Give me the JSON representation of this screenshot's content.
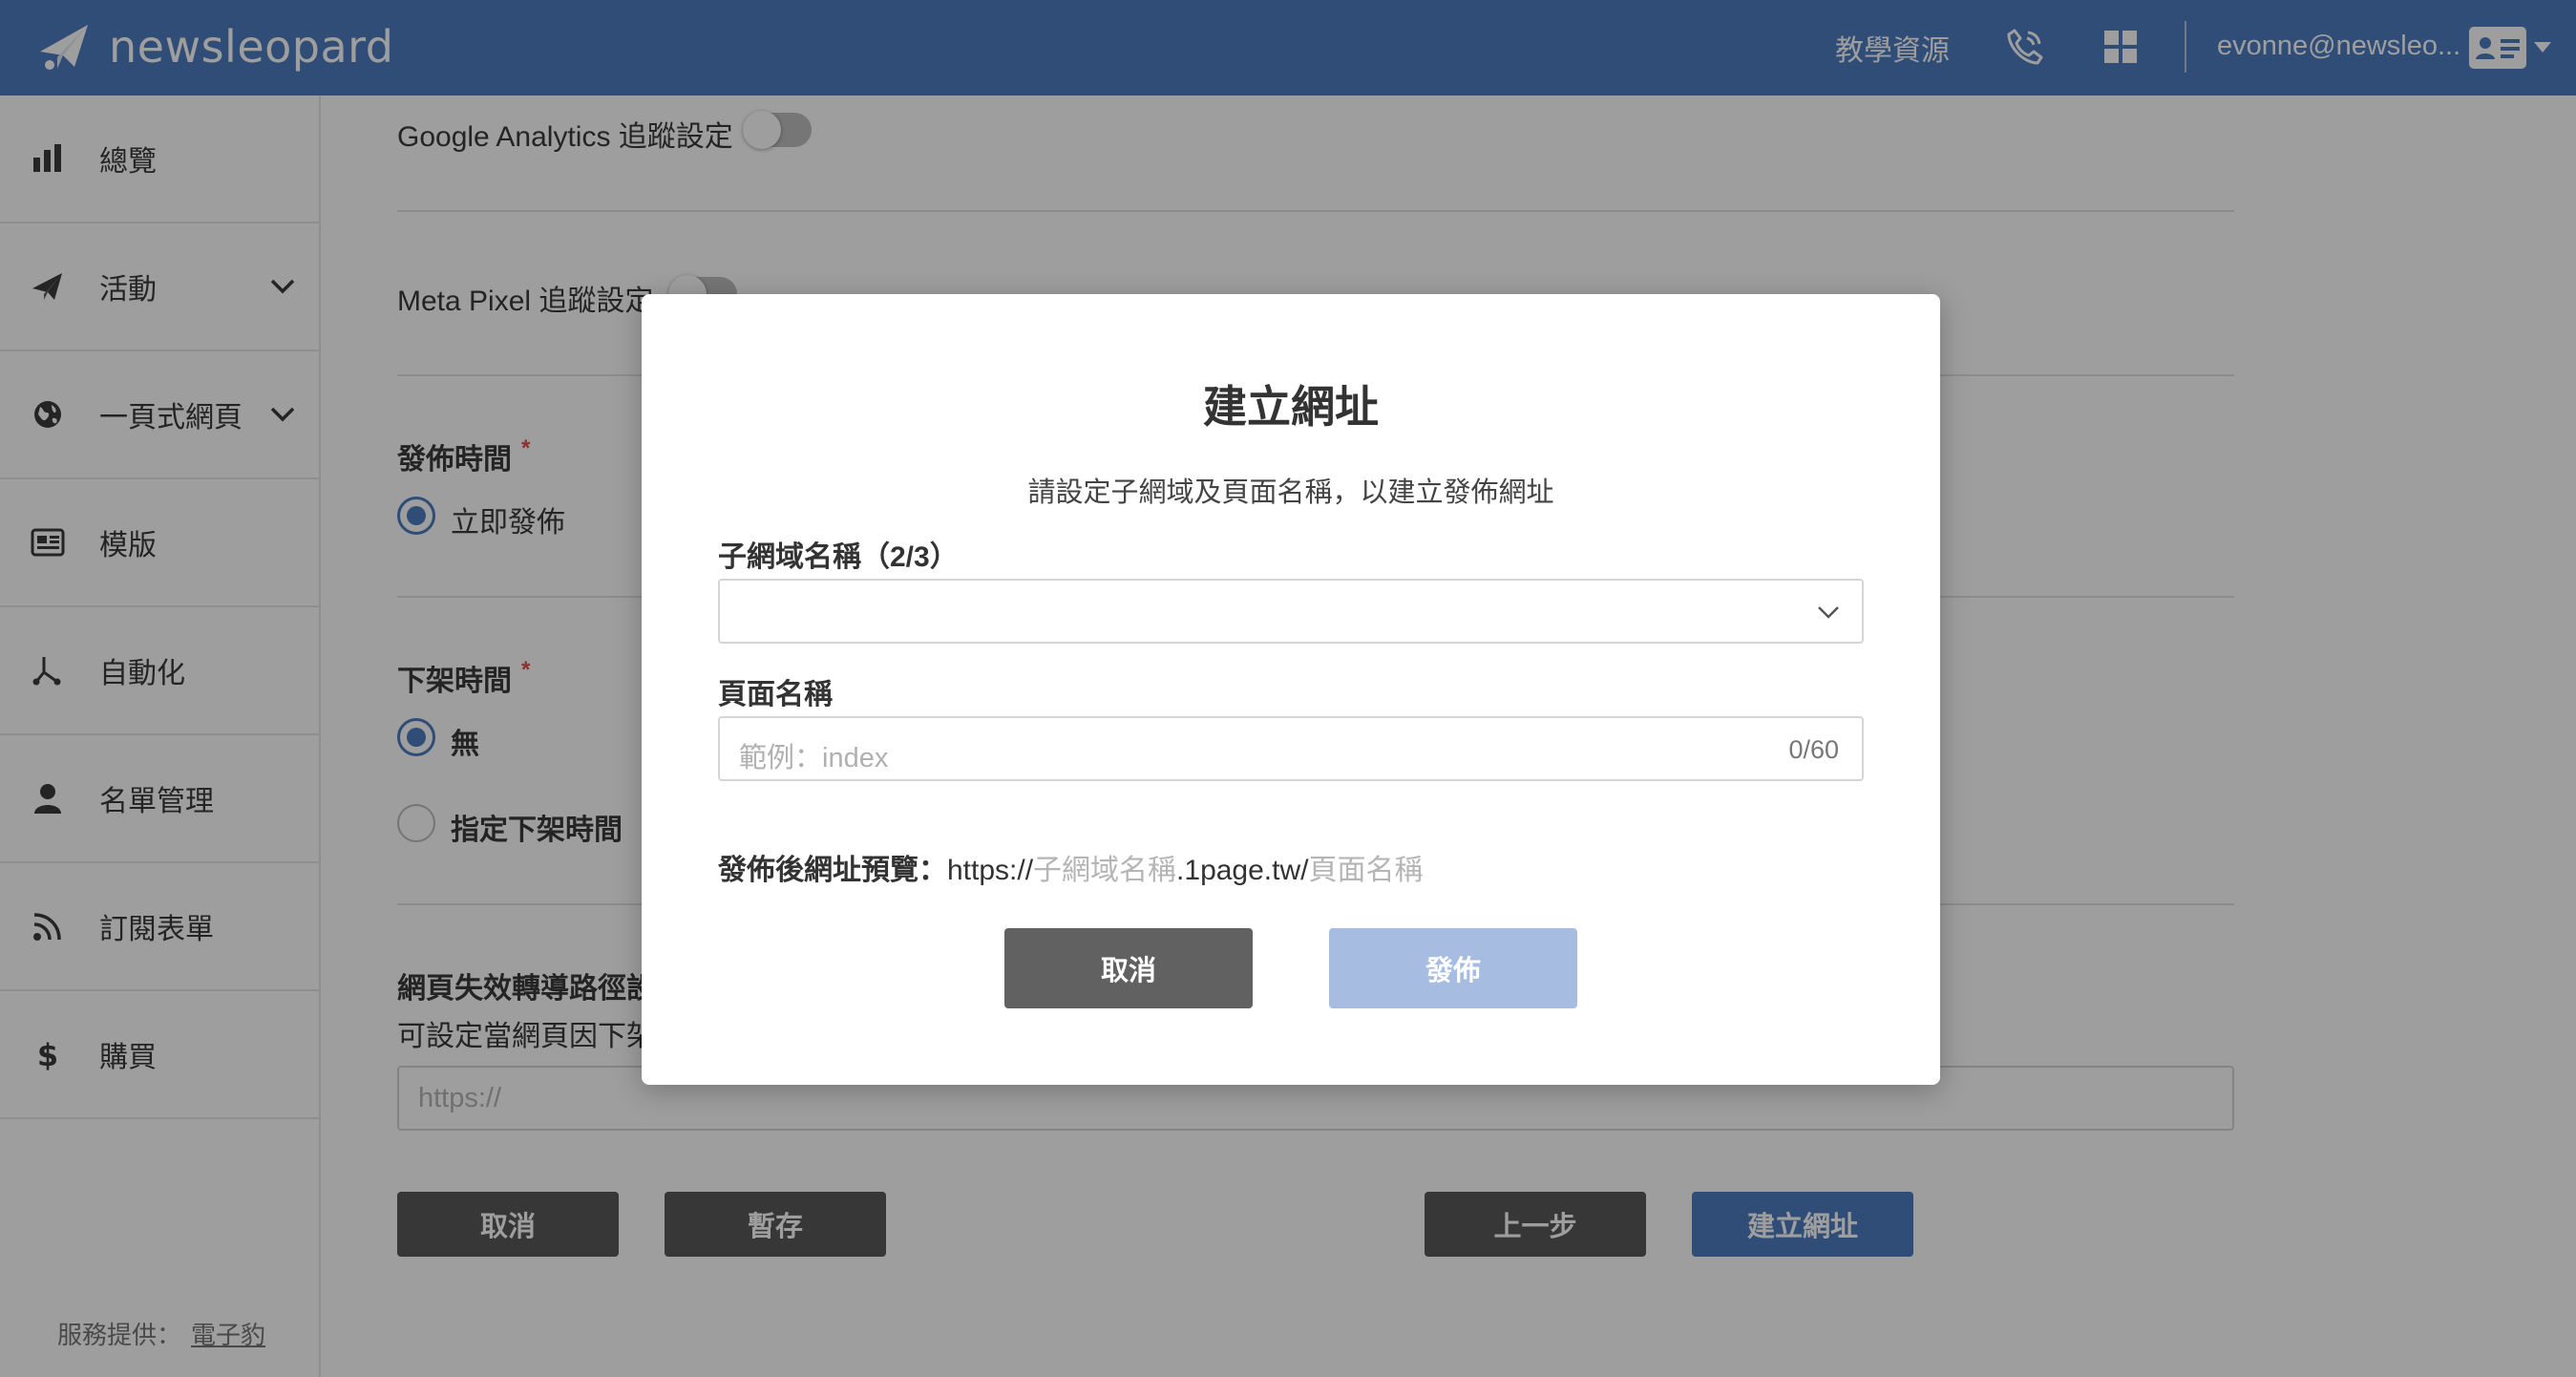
{
  "header": {
    "brand": "newsleopard",
    "resources_label": "教學資源",
    "user_email": "evonne@newsleo...",
    "colors": {
      "bar": "#4e7cc2"
    }
  },
  "sidebar": {
    "items": [
      {
        "label": "總覽",
        "icon": "bar-chart-icon",
        "has_submenu": false
      },
      {
        "label": "活動",
        "icon": "paper-plane-icon",
        "has_submenu": true
      },
      {
        "label": "一頁式網頁",
        "icon": "globe-icon",
        "has_submenu": true
      },
      {
        "label": "模版",
        "icon": "template-icon",
        "has_submenu": false
      },
      {
        "label": "自動化",
        "icon": "automation-icon",
        "has_submenu": false
      },
      {
        "label": "名單管理",
        "icon": "user-icon",
        "has_submenu": false
      },
      {
        "label": "訂閱表單",
        "icon": "rss-icon",
        "has_submenu": false
      },
      {
        "label": "購買",
        "icon": "dollar-icon",
        "has_submenu": false
      }
    ],
    "footer": {
      "prefix": "服務提供：",
      "link": "電子豹"
    }
  },
  "main": {
    "ga_label": "Google Analytics 追蹤設定",
    "meta_label": "Meta Pixel 追蹤設定",
    "publish_time": {
      "label": "發佈時間",
      "required_mark": "*",
      "option_now": "立即發佈"
    },
    "unpublish_time": {
      "label": "下架時間",
      "required_mark": "*",
      "option_none": "無",
      "option_specific": "指定下架時間"
    },
    "redirect": {
      "label": "網頁失效轉導路徑設",
      "description": "可設定當網頁因下架",
      "placeholder": "https://"
    },
    "buttons": {
      "cancel": "取消",
      "save_draft": "暫存",
      "previous": "上一步",
      "create_url": "建立網址"
    }
  },
  "modal": {
    "title": "建立網址",
    "subtitle": "請設定子網域及頁面名稱，以建立發佈網址",
    "subdomain_label": "子網域名稱（2/3）",
    "subdomain_value": "",
    "page_name_label": "頁面名稱",
    "page_name_placeholder": "範例：index",
    "page_name_counter": "0/60",
    "preview_label": "發佈後網址預覽：",
    "preview_scheme": "https://",
    "preview_subdomain": "子網域名稱",
    "preview_domain": ".1page.tw/",
    "preview_page": "頁面名稱",
    "cancel_label": "取消",
    "publish_label": "發佈"
  }
}
